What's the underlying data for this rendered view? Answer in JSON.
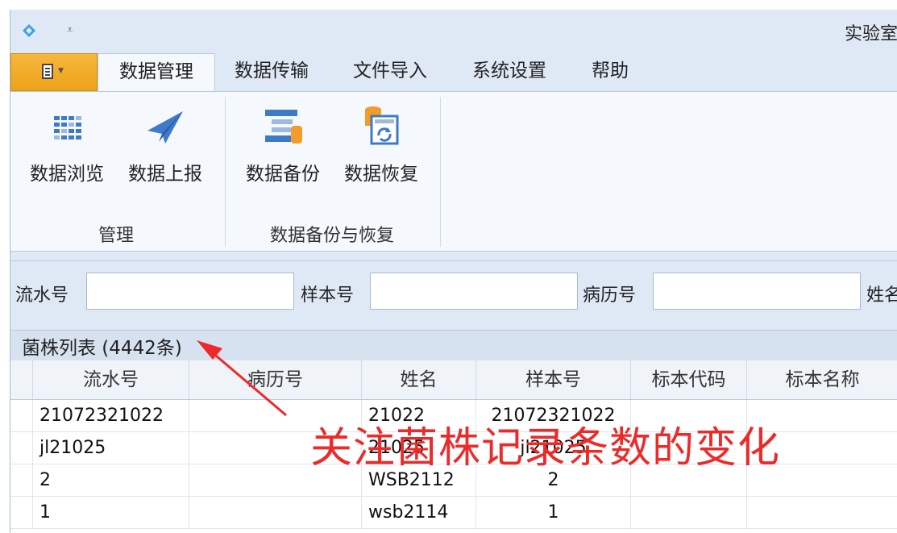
{
  "window": {
    "title": "实验室",
    "qat_symbol": "⩡"
  },
  "tabs": {
    "file_menu": "file-menu",
    "items": [
      "数据管理",
      "数据传输",
      "文件导入",
      "系统设置",
      "帮助"
    ],
    "active": "数据管理"
  },
  "ribbon": {
    "buttons": {
      "browse": "数据浏览",
      "report": "数据上报",
      "backup": "数据备份",
      "restore": "数据恢复"
    },
    "groups": {
      "manage": "管理",
      "backup_restore": "数据备份与恢复"
    }
  },
  "filter": {
    "serial_label": "流水号",
    "serial_value": "",
    "sample_label": "样本号",
    "sample_value": "",
    "record_label": "病历号",
    "record_value": "",
    "name_label": "姓名"
  },
  "grid": {
    "title": "菌株列表 (4442条)",
    "columns": [
      "流水号",
      "病历号",
      "姓名",
      "样本号",
      "标本代码",
      "标本名称"
    ],
    "rows": [
      [
        "21072321022",
        "",
        "21022",
        "21072321022",
        "",
        ""
      ],
      [
        "jl21025",
        "",
        "21025",
        "jl21025",
        "",
        ""
      ],
      [
        "2",
        "",
        "WSB2112",
        "2",
        "",
        ""
      ],
      [
        "1",
        "",
        "wsb2114",
        "1",
        "",
        ""
      ]
    ]
  },
  "annotation": {
    "text": "关注菌株记录条数的变化",
    "color": "#ec2a2a"
  },
  "colors": {
    "ribbon_bg": "#f5f9fd",
    "frame_bg": "#dfe9f5",
    "file_tab": "#f3ad2c",
    "icon_blue": "#3f79c9",
    "icon_orange": "#f39c2a"
  }
}
